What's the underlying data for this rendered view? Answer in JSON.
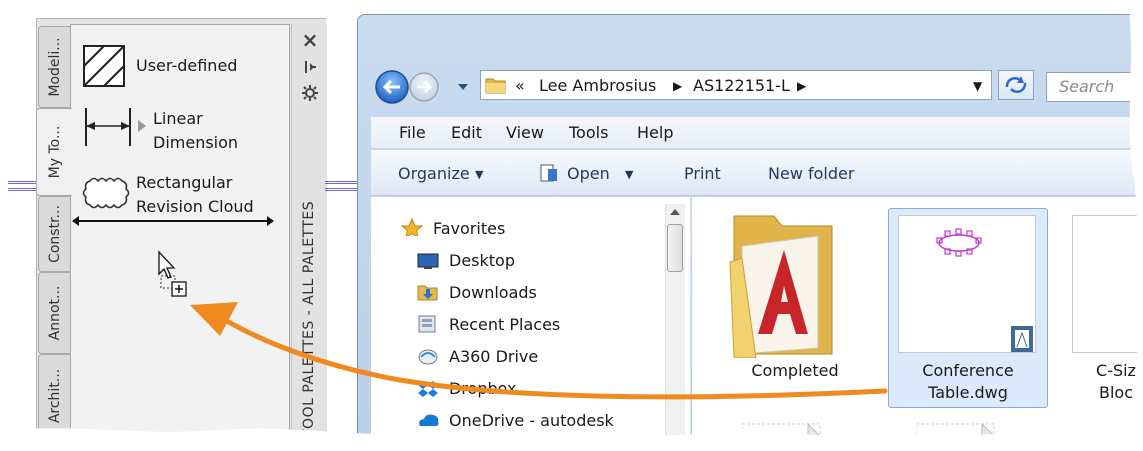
{
  "palette": {
    "tabs": [
      {
        "label": "Modeli..."
      },
      {
        "label": "My To..."
      },
      {
        "label": "Constr..."
      },
      {
        "label": "Annot..."
      },
      {
        "label": "Archit..."
      }
    ],
    "tools": {
      "hatch_label": "User-defined",
      "dim_line1": "Linear",
      "dim_line2": "Dimension",
      "cloud_line1": "Rectangular",
      "cloud_line2": "Revision Cloud"
    },
    "side_title": "TOOL PALETTES - ALL PALETTES",
    "close_icon": "×"
  },
  "explorer": {
    "breadcrumb": {
      "overflow": "«",
      "parts": [
        "Lee Ambrosius",
        "AS122151-L"
      ]
    },
    "search_placeholder": "Search",
    "menu": [
      "File",
      "Edit",
      "View",
      "Tools",
      "Help"
    ],
    "commands": [
      "Organize",
      "Open",
      "Print",
      "New folder"
    ],
    "nav": {
      "favorites": "Favorites",
      "items": [
        "Desktop",
        "Downloads",
        "Recent Places",
        "A360 Drive",
        "Dropbox",
        "OneDrive - autodesk"
      ]
    },
    "files": {
      "folder_name": "Completed",
      "selected_line1": "Conference",
      "selected_line2": "Table.dwg",
      "partial_line1": "C-Siz",
      "partial_line2": "Bloc"
    }
  },
  "colors": {
    "accent_arrow": "#f08a1e",
    "selection": "#dbe9fb",
    "window_frame": "#b9cfe8"
  }
}
